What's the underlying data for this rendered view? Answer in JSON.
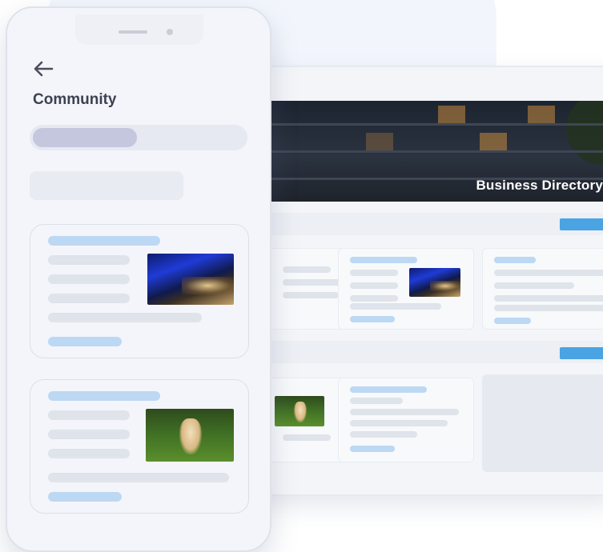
{
  "phone": {
    "title": "Community",
    "back_icon": "arrow-left-icon",
    "cards": [
      {
        "thumbnail": "blue-tunnel-photo"
      },
      {
        "thumbnail": "puppy-on-grass-photo"
      }
    ]
  },
  "desktop": {
    "hero_title": "Business Directory",
    "hero_image": "apartment-building-night-photo"
  },
  "colors": {
    "accent_blue": "#4aa3e2",
    "placeholder_blue": "#bcd8f3",
    "placeholder_gray": "#dfe3ea",
    "tab_active": "#c4c7dd"
  }
}
